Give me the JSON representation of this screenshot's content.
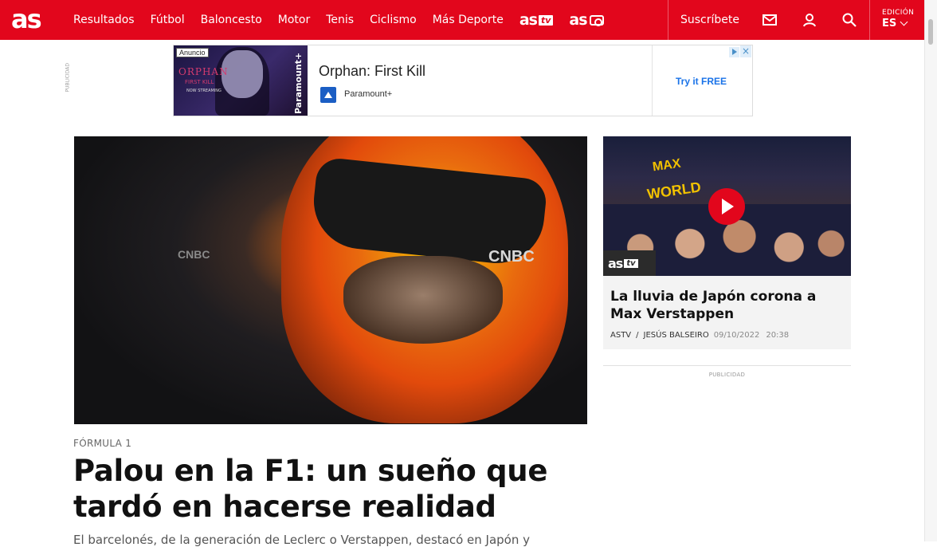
{
  "header": {
    "logo": "as",
    "nav": [
      "Resultados",
      "Fútbol",
      "Baloncesto",
      "Motor",
      "Tenis",
      "Ciclismo",
      "Más Deporte"
    ],
    "brand_tv": {
      "text": "as",
      "badge": "tv"
    },
    "brand_photo": {
      "text": "as"
    },
    "subscribe": "Suscríbete",
    "edition_label": "EDICIÓN",
    "edition_value": "ES",
    "colors": {
      "accent": "#e2061c"
    }
  },
  "ad": {
    "side_label": "PUBLICIDAD",
    "badge": "Anuncio",
    "title": "Orphan: First Kill",
    "brand": "Paramount+",
    "cta": "Try it FREE",
    "image_text": {
      "orphan": "ORPHAN",
      "first_kill": "FIRST KILL",
      "now": "NOW STREAMING",
      "paramount": "Paramount+"
    }
  },
  "article": {
    "section": "FÓRMULA 1",
    "headline": "Palou en la F1: un sueño que tardó en hacerse realidad",
    "lede": "El barcelonés, de la generación de Leclerc o Verstappen, destacó en Japón y",
    "image_text": {
      "sponsor1": "CNBC",
      "sponsor2": "CNBC"
    }
  },
  "sidebar": {
    "video": {
      "image_text": {
        "line1": "MAX",
        "line2": "WORLD"
      },
      "badge_as": "as",
      "badge_tv": "tv",
      "title": "La lluvia de Japón corona a Max Verstappen",
      "source": "ASTV",
      "author": "JESÚS BALSEIRO",
      "date": "09/10/2022",
      "time": "20:38"
    },
    "pub_label": "PUBLICIDAD"
  }
}
